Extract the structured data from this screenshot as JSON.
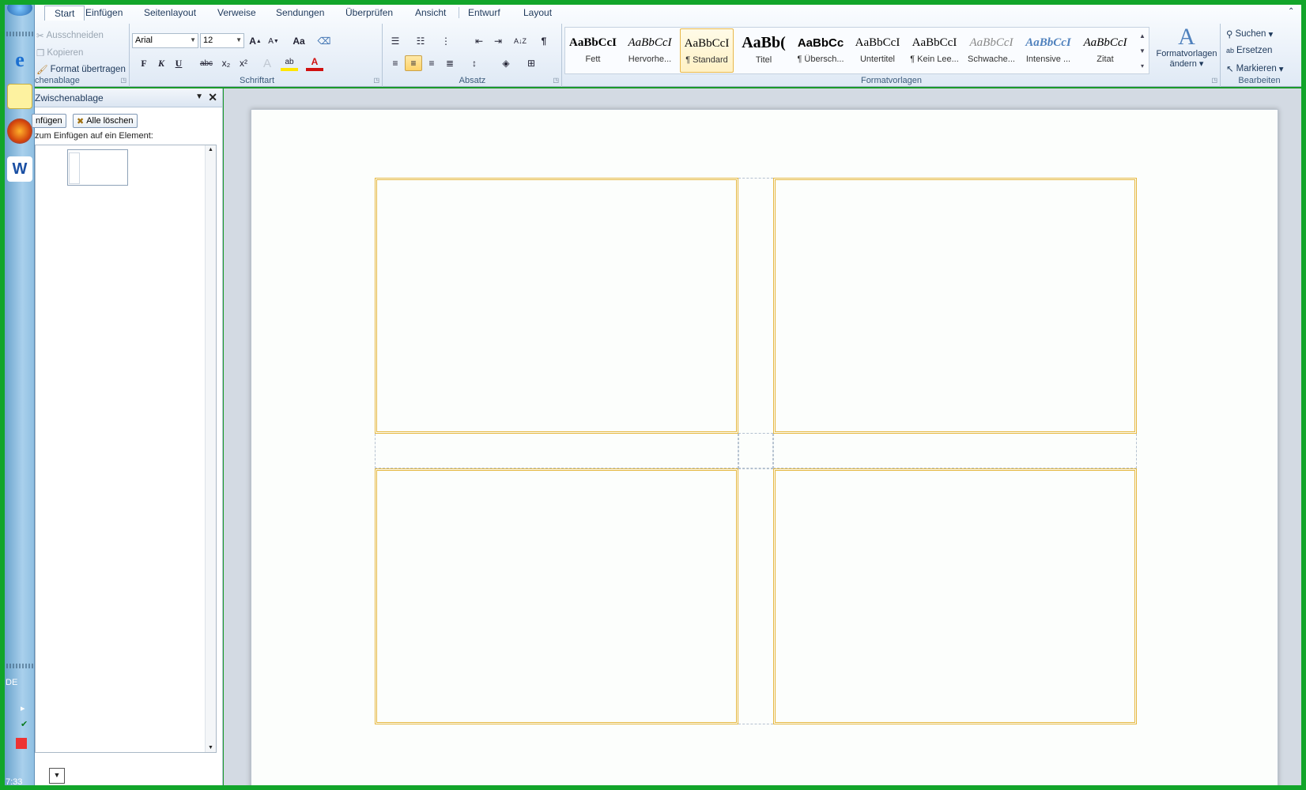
{
  "taskbar": {
    "language": "DE",
    "clock": "7:33",
    "icons": [
      "windows-start-icon",
      "internet-explorer-icon",
      "notepad-icon",
      "firefox-icon",
      "word-icon"
    ]
  },
  "ribbon": {
    "tabs": [
      "Start",
      "Einfügen",
      "Seitenlayout",
      "Verweise",
      "Sendungen",
      "Überprüfen",
      "Ansicht",
      "Entwurf",
      "Layout"
    ],
    "active_tab": "Start",
    "clipboard": {
      "label": "chenablage",
      "cut": "Ausschneiden",
      "copy": "Kopieren",
      "format_painter": "Format übertragen"
    },
    "font": {
      "label": "Schriftart",
      "font_name": "Arial",
      "font_size": "12",
      "bold": "F",
      "italic": "K",
      "underline": "U",
      "strike": "abc",
      "subscript": "x₂",
      "superscript": "x²",
      "grow": "A",
      "shrink": "A",
      "case": "Aa",
      "highlight": "ab",
      "font_color": "A",
      "highlight_color": "#ffe600",
      "font_color_value": "#d01010"
    },
    "paragraph": {
      "label": "Absatz",
      "pilcrow": "¶",
      "sort": "A↓Z"
    },
    "styles": {
      "label": "Formatvorlagen",
      "sample": "AaBbCcI",
      "items": [
        {
          "sample": "AaBbCcI",
          "name": "Fett"
        },
        {
          "sample": "AaBbCcI",
          "name": "Hervorhe..."
        },
        {
          "sample": "AaBbCcI",
          "name": "¶ Standard"
        },
        {
          "sample": "AaBb(",
          "name": "Titel"
        },
        {
          "sample": "AaBbCc",
          "name": "¶ Übersch..."
        },
        {
          "sample": "AaBbCcI",
          "name": "Untertitel"
        },
        {
          "sample": "AaBbCcI",
          "name": "¶ Kein Lee..."
        },
        {
          "sample": "AaBbCcI",
          "name": "Schwache..."
        },
        {
          "sample": "AaBbCcI",
          "name": "Intensive ..."
        },
        {
          "sample": "AaBbCcI",
          "name": "Zitat"
        }
      ],
      "change_line1": "Formatvorlagen",
      "change_line2": "ändern"
    },
    "editing": {
      "label": "Bearbeiten",
      "find": "Suchen",
      "replace": "Ersetzen",
      "select": "Markieren"
    }
  },
  "clipboard_pane": {
    "title": "Zwischenablage",
    "paste_all": "nfügen",
    "clear_all": "Alle löschen",
    "hint": "zum Einfügen auf ein Element:"
  },
  "document": {
    "label_grid": "2 x 2 labels"
  }
}
